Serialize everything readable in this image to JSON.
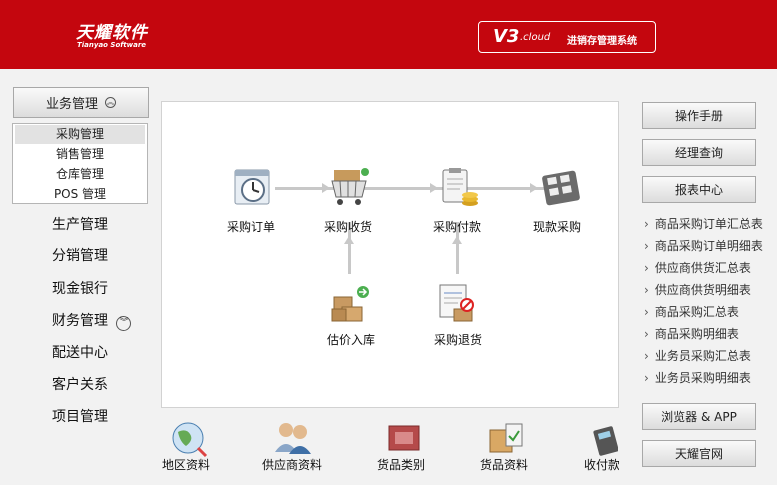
{
  "header": {
    "logo_cn": "天耀软件",
    "logo_en": "Tianyao Software",
    "version": "V3",
    "version_suffix": ".cloud",
    "system_name": "进销存管理系统"
  },
  "sidebar": {
    "expanded": {
      "label": "业务管理",
      "subitems": [
        "采购管理",
        "销售管理",
        "仓库管理",
        "POS 管理"
      ],
      "active": 0
    },
    "items": [
      "生产管理",
      "分销管理",
      "现金银行",
      "财务管理",
      "配送中心",
      "客户关系",
      "项目管理"
    ]
  },
  "flow": {
    "nodes": [
      {
        "label": "采购订单",
        "icon": "clock-document-icon"
      },
      {
        "label": "采购收货",
        "icon": "shopping-cart-icon"
      },
      {
        "label": "采购付款",
        "icon": "clipboard-coins-icon"
      },
      {
        "label": "现款采购",
        "icon": "calculator-icon"
      },
      {
        "label": "估价入库",
        "icon": "boxes-in-icon"
      },
      {
        "label": "采购退货",
        "icon": "return-document-icon"
      }
    ]
  },
  "bottom": [
    "地区资料",
    "供应商资料",
    "货品类别",
    "货品资料",
    "收付款"
  ],
  "right": {
    "manual": "操作手册",
    "manager_query": "经理查询",
    "report_center": "报表中心",
    "reports": [
      "商品采购订单汇总表",
      "商品采购订单明细表",
      "供应商供货汇总表",
      "供应商供货明细表",
      "商品采购汇总表",
      "商品采购明细表",
      "业务员采购汇总表",
      "业务员采购明细表"
    ],
    "browser_app": "浏览器 & APP",
    "website": "天耀官网"
  },
  "colors": {
    "header": "#c4060e"
  }
}
